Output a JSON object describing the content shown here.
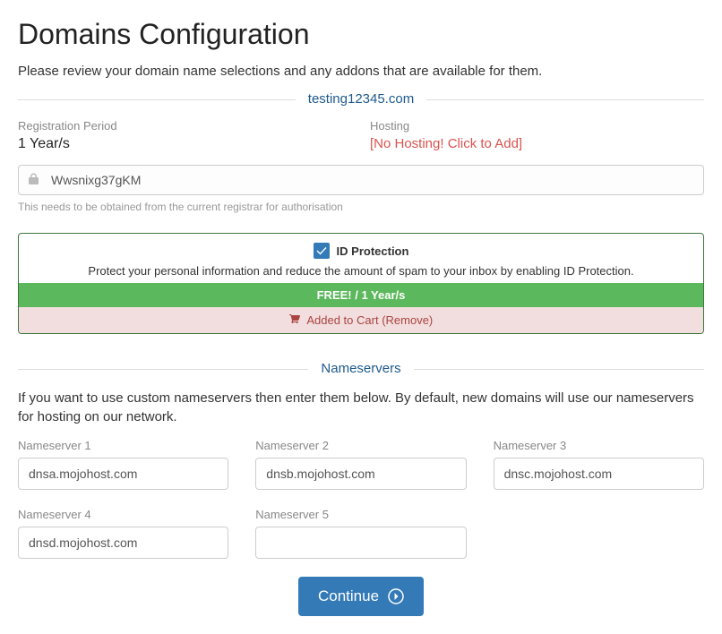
{
  "page_title": "Domains Configuration",
  "intro": "Please review your domain name selections and any addons that are available for them.",
  "domain_name": "testing12345.com",
  "registration": {
    "label": "Registration Period",
    "value": "1 Year/s"
  },
  "hosting": {
    "label": "Hosting",
    "link_text": "[No Hosting! Click to Add]"
  },
  "epp": {
    "value": "Wwsnixg37gKM",
    "help": "This needs to be obtained from the current registrar for authorisation"
  },
  "addon": {
    "title": "ID Protection",
    "checked": true,
    "desc": "Protect your personal information and reduce the amount of spam to your inbox by enabling ID Protection.",
    "price": "FREE! / 1 Year/s",
    "status_prefix": " Added to Cart ",
    "remove_label": "(Remove)"
  },
  "nameservers": {
    "section_title": "Nameservers",
    "intro": "If you want to use custom nameservers then enter them below. By default, new domains will use our nameservers for hosting on our network.",
    "items": [
      {
        "label": "Nameserver 1",
        "value": "dnsa.mojohost.com"
      },
      {
        "label": "Nameserver 2",
        "value": "dnsb.mojohost.com"
      },
      {
        "label": "Nameserver 3",
        "value": "dnsc.mojohost.com"
      },
      {
        "label": "Nameserver 4",
        "value": "dnsd.mojohost.com"
      },
      {
        "label": "Nameserver 5",
        "value": ""
      }
    ]
  },
  "continue_label": "Continue"
}
